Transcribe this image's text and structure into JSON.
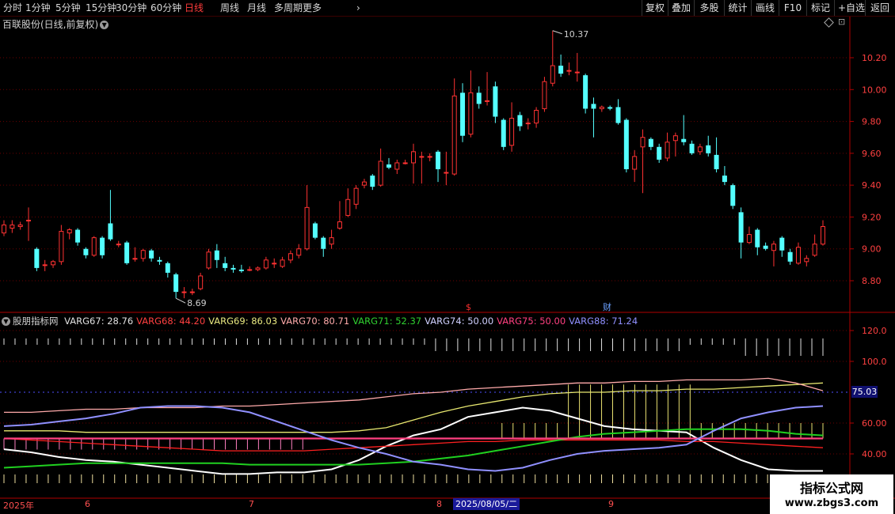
{
  "toolbar": {
    "periods": [
      {
        "label": "分时",
        "active": false
      },
      {
        "label": "1分钟",
        "active": false
      },
      {
        "label": "5分钟",
        "active": false
      },
      {
        "label": "15分钟",
        "active": false
      },
      {
        "label": "30分钟",
        "active": false
      },
      {
        "label": "60分钟",
        "active": false
      },
      {
        "label": "日线",
        "active": true
      },
      {
        "label": "周线",
        "active": false
      },
      {
        "label": "月线",
        "active": false
      },
      {
        "label": "多周期",
        "active": false
      },
      {
        "label": "更多",
        "active": false
      }
    ],
    "more_arrow": "›",
    "actions": [
      "复权",
      "叠加",
      "多股",
      "统计",
      "画线",
      "F10",
      "标记",
      "+自选",
      "返回"
    ]
  },
  "stock_title": "百联股份(日线,前复权)",
  "price_axis": {
    "labels": [
      "10.20",
      "10.00",
      "9.80",
      "9.60",
      "9.40",
      "9.20",
      "9.00",
      "8.80"
    ]
  },
  "indicator_axis": {
    "labels": [
      "120.0",
      "100.0",
      "60.00",
      "40.00"
    ]
  },
  "annotations": {
    "high_label": "10.37",
    "low_label": "8.69",
    "marker_1": "$",
    "marker_2": "财"
  },
  "indicator": {
    "name": "股朋指标网",
    "values": [
      {
        "label": "VARG67: 28.76",
        "color": "#e0e0e0"
      },
      {
        "label": "VARG68: 44.20",
        "color": "#ff4040"
      },
      {
        "label": "VARG69: 86.03",
        "color": "#e8e880"
      },
      {
        "label": "VARG70: 80.71",
        "color": "#ffaaaa"
      },
      {
        "label": "VARG71: 52.37",
        "color": "#30d030"
      },
      {
        "label": "VARG74: 50.00",
        "color": "#d0d0ff"
      },
      {
        "label": "VARG75: 50.00",
        "color": "#ff4080"
      },
      {
        "label": "VARG88: 71.24",
        "color": "#9090ff"
      }
    ],
    "readout": "75.03"
  },
  "date_axis": {
    "labels": [
      "2025年",
      "6",
      "7",
      "8",
      "9"
    ],
    "cursor_date": "2025/08/05/二"
  },
  "watermark": {
    "line1": "指标公式网",
    "line2": "www.zbgs3.com"
  },
  "chart_data": {
    "type": "candlestick",
    "title": "百联股份(日线,前复权)",
    "price_range": [
      8.6,
      10.46
    ],
    "candles": [
      {
        "o": 9.1,
        "c": 9.15,
        "h": 9.18,
        "l": 9.08
      },
      {
        "o": 9.13,
        "c": 9.15,
        "h": 9.18,
        "l": 9.1
      },
      {
        "o": 9.14,
        "c": 9.15,
        "h": 9.17,
        "l": 9.12
      },
      {
        "o": 9.18,
        "c": 9.18,
        "h": 9.26,
        "l": 9.05
      },
      {
        "o": 9.0,
        "c": 8.88,
        "h": 9.01,
        "l": 8.86
      },
      {
        "o": 8.9,
        "c": 8.9,
        "h": 8.93,
        "l": 8.86
      },
      {
        "o": 8.9,
        "c": 8.92,
        "h": 8.93,
        "l": 8.88
      },
      {
        "o": 8.92,
        "c": 9.11,
        "h": 9.15,
        "l": 8.9
      },
      {
        "o": 9.1,
        "c": 9.12,
        "h": 9.13,
        "l": 9.06
      },
      {
        "o": 9.12,
        "c": 9.04,
        "h": 9.13,
        "l": 9.02
      },
      {
        "o": 9.0,
        "c": 8.96,
        "h": 9.01,
        "l": 8.94
      },
      {
        "o": 8.96,
        "c": 9.07,
        "h": 9.08,
        "l": 8.95
      },
      {
        "o": 9.07,
        "c": 8.96,
        "h": 9.08,
        "l": 8.94
      },
      {
        "o": 9.16,
        "c": 9.06,
        "h": 9.37,
        "l": 9.05
      },
      {
        "o": 9.03,
        "c": 9.03,
        "h": 9.05,
        "l": 9.01
      },
      {
        "o": 9.04,
        "c": 8.91,
        "h": 9.05,
        "l": 8.9
      },
      {
        "o": 8.94,
        "c": 8.94,
        "h": 9.01,
        "l": 8.92
      },
      {
        "o": 8.94,
        "c": 8.99,
        "h": 9.0,
        "l": 8.92
      },
      {
        "o": 8.99,
        "c": 8.94,
        "h": 9.0,
        "l": 8.92
      },
      {
        "o": 8.93,
        "c": 8.92,
        "h": 8.95,
        "l": 8.9
      },
      {
        "o": 8.91,
        "c": 8.85,
        "h": 8.92,
        "l": 8.82
      },
      {
        "o": 8.84,
        "c": 8.73,
        "h": 8.85,
        "l": 8.69
      },
      {
        "o": 8.73,
        "c": 8.73,
        "h": 8.76,
        "l": 8.69
      },
      {
        "o": 8.73,
        "c": 8.73,
        "h": 8.75,
        "l": 8.71
      },
      {
        "o": 8.75,
        "c": 8.83,
        "h": 8.85,
        "l": 8.74
      },
      {
        "o": 8.88,
        "c": 8.98,
        "h": 9.0,
        "l": 8.87
      },
      {
        "o": 8.99,
        "c": 8.93,
        "h": 9.03,
        "l": 8.88
      },
      {
        "o": 8.91,
        "c": 8.88,
        "h": 8.95,
        "l": 8.86
      },
      {
        "o": 8.88,
        "c": 8.87,
        "h": 8.9,
        "l": 8.85
      },
      {
        "o": 8.87,
        "c": 8.86,
        "h": 8.9,
        "l": 8.85
      },
      {
        "o": 8.87,
        "c": 8.87,
        "h": 8.89,
        "l": 8.86
      },
      {
        "o": 8.87,
        "c": 8.88,
        "h": 8.89,
        "l": 8.86
      },
      {
        "o": 8.88,
        "c": 8.93,
        "h": 8.95,
        "l": 8.87
      },
      {
        "o": 8.91,
        "c": 8.91,
        "h": 8.94,
        "l": 8.88
      },
      {
        "o": 8.89,
        "c": 8.93,
        "h": 8.95,
        "l": 8.88
      },
      {
        "o": 8.93,
        "c": 8.97,
        "h": 8.99,
        "l": 8.91
      },
      {
        "o": 8.96,
        "c": 9.0,
        "h": 9.03,
        "l": 8.94
      },
      {
        "o": 9.0,
        "c": 9.26,
        "h": 9.4,
        "l": 8.99
      },
      {
        "o": 9.16,
        "c": 9.07,
        "h": 9.17,
        "l": 9.06
      },
      {
        "o": 9.07,
        "c": 9.0,
        "h": 9.08,
        "l": 8.95
      },
      {
        "o": 9.03,
        "c": 9.07,
        "h": 9.12,
        "l": 9.0
      },
      {
        "o": 9.13,
        "c": 9.17,
        "h": 9.3,
        "l": 9.12
      },
      {
        "o": 9.21,
        "c": 9.31,
        "h": 9.38,
        "l": 9.2
      },
      {
        "o": 9.28,
        "c": 9.38,
        "h": 9.4,
        "l": 9.25
      },
      {
        "o": 9.4,
        "c": 9.42,
        "h": 9.44,
        "l": 9.38
      },
      {
        "o": 9.46,
        "c": 9.39,
        "h": 9.47,
        "l": 9.37
      },
      {
        "o": 9.4,
        "c": 9.55,
        "h": 9.63,
        "l": 9.39
      },
      {
        "o": 9.53,
        "c": 9.51,
        "h": 9.57,
        "l": 9.5
      },
      {
        "o": 9.5,
        "c": 9.54,
        "h": 9.56,
        "l": 9.47
      },
      {
        "o": 9.54,
        "c": 9.54,
        "h": 9.56,
        "l": 9.53
      },
      {
        "o": 9.54,
        "c": 9.61,
        "h": 9.66,
        "l": 9.41
      },
      {
        "o": 9.58,
        "c": 9.58,
        "h": 9.61,
        "l": 9.41
      },
      {
        "o": 9.58,
        "c": 9.58,
        "h": 9.6,
        "l": 9.55
      },
      {
        "o": 9.61,
        "c": 9.5,
        "h": 9.62,
        "l": 9.42
      },
      {
        "o": 9.48,
        "c": 9.48,
        "h": 9.61,
        "l": 9.4
      },
      {
        "o": 9.47,
        "c": 9.96,
        "h": 10.07,
        "l": 9.46
      },
      {
        "o": 9.98,
        "c": 9.71,
        "h": 10.04,
        "l": 9.67
      },
      {
        "o": 9.72,
        "c": 9.98,
        "h": 10.12,
        "l": 9.7
      },
      {
        "o": 9.98,
        "c": 9.91,
        "h": 10.02,
        "l": 9.88
      },
      {
        "o": 9.93,
        "c": 9.93,
        "h": 10.11,
        "l": 9.9
      },
      {
        "o": 10.02,
        "c": 9.83,
        "h": 10.05,
        "l": 9.79
      },
      {
        "o": 9.81,
        "c": 9.64,
        "h": 9.82,
        "l": 9.62
      },
      {
        "o": 9.65,
        "c": 9.82,
        "h": 9.92,
        "l": 9.61
      },
      {
        "o": 9.84,
        "c": 9.77,
        "h": 9.86,
        "l": 9.74
      },
      {
        "o": 9.79,
        "c": 9.79,
        "h": 9.82,
        "l": 9.75
      },
      {
        "o": 9.79,
        "c": 9.87,
        "h": 9.89,
        "l": 9.76
      },
      {
        "o": 9.88,
        "c": 10.05,
        "h": 10.08,
        "l": 9.86
      },
      {
        "o": 10.04,
        "c": 10.15,
        "h": 10.37,
        "l": 10.02
      },
      {
        "o": 10.15,
        "c": 10.1,
        "h": 10.22,
        "l": 10.08
      },
      {
        "o": 10.12,
        "c": 10.12,
        "h": 10.17,
        "l": 10.09
      },
      {
        "o": 10.11,
        "c": 10.11,
        "h": 10.23,
        "l": 10.05
      },
      {
        "o": 10.09,
        "c": 9.88,
        "h": 10.1,
        "l": 9.85
      },
      {
        "o": 9.91,
        "c": 9.88,
        "h": 9.95,
        "l": 9.7
      },
      {
        "o": 9.88,
        "c": 9.89,
        "h": 9.9,
        "l": 9.86
      },
      {
        "o": 9.89,
        "c": 9.88,
        "h": 9.9,
        "l": 9.87
      },
      {
        "o": 9.89,
        "c": 9.79,
        "h": 9.94,
        "l": 9.78
      },
      {
        "o": 9.81,
        "c": 9.5,
        "h": 9.82,
        "l": 9.48
      },
      {
        "o": 9.5,
        "c": 9.58,
        "h": 9.62,
        "l": 9.42
      },
      {
        "o": 9.64,
        "c": 9.7,
        "h": 9.75,
        "l": 9.35
      },
      {
        "o": 9.69,
        "c": 9.64,
        "h": 9.7,
        "l": 9.62
      },
      {
        "o": 9.64,
        "c": 9.56,
        "h": 9.66,
        "l": 9.54
      },
      {
        "o": 9.57,
        "c": 9.67,
        "h": 9.73,
        "l": 9.55
      },
      {
        "o": 9.68,
        "c": 9.71,
        "h": 9.73,
        "l": 9.58
      },
      {
        "o": 9.69,
        "c": 9.67,
        "h": 9.84,
        "l": 9.65
      },
      {
        "o": 9.66,
        "c": 9.6,
        "h": 9.68,
        "l": 9.59
      },
      {
        "o": 9.61,
        "c": 9.64,
        "h": 9.66,
        "l": 9.59
      },
      {
        "o": 9.65,
        "c": 9.6,
        "h": 9.71,
        "l": 9.58
      },
      {
        "o": 9.59,
        "c": 9.5,
        "h": 9.7,
        "l": 9.48
      },
      {
        "o": 9.46,
        "c": 9.42,
        "h": 9.52,
        "l": 9.4
      },
      {
        "o": 9.4,
        "c": 9.27,
        "h": 9.41,
        "l": 9.25
      },
      {
        "o": 9.23,
        "c": 9.04,
        "h": 9.26,
        "l": 8.94
      },
      {
        "o": 9.04,
        "c": 9.09,
        "h": 9.14,
        "l": 9.03
      },
      {
        "o": 9.12,
        "c": 9.01,
        "h": 9.13,
        "l": 8.96
      },
      {
        "o": 9.02,
        "c": 9.0,
        "h": 9.04,
        "l": 8.99
      },
      {
        "o": 8.99,
        "c": 9.03,
        "h": 9.05,
        "l": 8.89
      },
      {
        "o": 9.07,
        "c": 8.99,
        "h": 9.08,
        "l": 8.95
      },
      {
        "o": 8.98,
        "c": 8.92,
        "h": 9.0,
        "l": 8.9
      },
      {
        "o": 8.91,
        "c": 9.01,
        "h": 9.04,
        "l": 8.9
      },
      {
        "o": 8.92,
        "c": 8.94,
        "h": 8.96,
        "l": 8.89
      },
      {
        "o": 8.96,
        "c": 9.03,
        "h": 9.09,
        "l": 8.95
      },
      {
        "o": 9.03,
        "c": 9.14,
        "h": 9.18,
        "l": 9.02
      }
    ],
    "indicator_range": [
      20,
      128
    ],
    "indicator_series": [
      {
        "name": "VARG67",
        "color": "#ffffff",
        "values": [
          43,
          41,
          38,
          36,
          35,
          33,
          31,
          29,
          27,
          27,
          28,
          28,
          30,
          36,
          45,
          52,
          56,
          64,
          67,
          70,
          68,
          63,
          58,
          56,
          55,
          54,
          44,
          36,
          30,
          29,
          29
        ]
      },
      {
        "name": "VARG68",
        "color": "#ff2020",
        "values": [
          50,
          49,
          48,
          47,
          46,
          45,
          44,
          43,
          42,
          42,
          42,
          42,
          43,
          44,
          45,
          46,
          47,
          48,
          48,
          49,
          49,
          49,
          49,
          49,
          49,
          48,
          48,
          47,
          46,
          45,
          44
        ]
      },
      {
        "name": "VARG69",
        "color": "#e8e870",
        "values": [
          55,
          55,
          55,
          54,
          54,
          54,
          54,
          54,
          54,
          54,
          54,
          54,
          54,
          55,
          57,
          62,
          67,
          71,
          74,
          77,
          79,
          80,
          80,
          81,
          81,
          82,
          82,
          83,
          84,
          85,
          86
        ]
      },
      {
        "name": "VARG70",
        "color": "#ffaaaa",
        "values": [
          67,
          67,
          68,
          69,
          69,
          70,
          70,
          70,
          71,
          71,
          72,
          73,
          74,
          75,
          77,
          79,
          80,
          82,
          83,
          84,
          85,
          86,
          86,
          87,
          87,
          88,
          88,
          88,
          89,
          86,
          81
        ]
      },
      {
        "name": "VARG71",
        "color": "#20d020",
        "values": [
          31,
          32,
          33,
          34,
          34,
          34,
          34,
          34,
          34,
          33,
          33,
          33,
          33,
          33,
          34,
          35,
          37,
          39,
          42,
          45,
          48,
          51,
          53,
          54,
          55,
          56,
          56,
          56,
          55,
          53,
          52
        ]
      },
      {
        "name": "VARG74",
        "color": "#d0d0ff",
        "values": [
          50,
          50,
          50,
          50,
          50,
          50,
          50,
          50,
          50,
          50,
          50,
          50,
          50,
          50,
          50,
          50,
          50,
          50,
          50,
          50,
          50,
          50,
          50,
          50,
          50,
          50,
          50,
          50,
          50,
          50,
          50
        ]
      },
      {
        "name": "VARG75",
        "color": "#ff4080",
        "values": [
          50,
          50,
          50,
          50,
          50,
          50,
          50,
          50,
          50,
          50,
          50,
          50,
          50,
          50,
          50,
          50,
          50,
          50,
          50,
          50,
          50,
          50,
          50,
          50,
          50,
          50,
          50,
          50,
          50,
          50,
          50
        ]
      },
      {
        "name": "VARG88",
        "color": "#9090ff",
        "values": [
          58,
          59,
          61,
          63,
          66,
          70,
          71,
          71,
          70,
          67,
          61,
          55,
          49,
          44,
          40,
          35,
          33,
          30,
          29,
          31,
          36,
          40,
          42,
          43,
          44,
          46,
          55,
          63,
          67,
          70,
          71
        ]
      }
    ],
    "ticks_top": [
      113,
      113,
      113,
      113,
      113,
      113,
      113,
      113,
      113,
      113,
      113,
      113,
      113,
      113,
      113,
      113,
      113,
      113,
      113,
      113,
      113,
      113,
      113,
      113,
      113,
      113,
      113,
      113,
      113,
      113,
      113
    ],
    "colors": {
      "up": "#ff3232",
      "down": "#54ffff",
      "grid": "#6b0000",
      "axis": "#b00000"
    }
  }
}
